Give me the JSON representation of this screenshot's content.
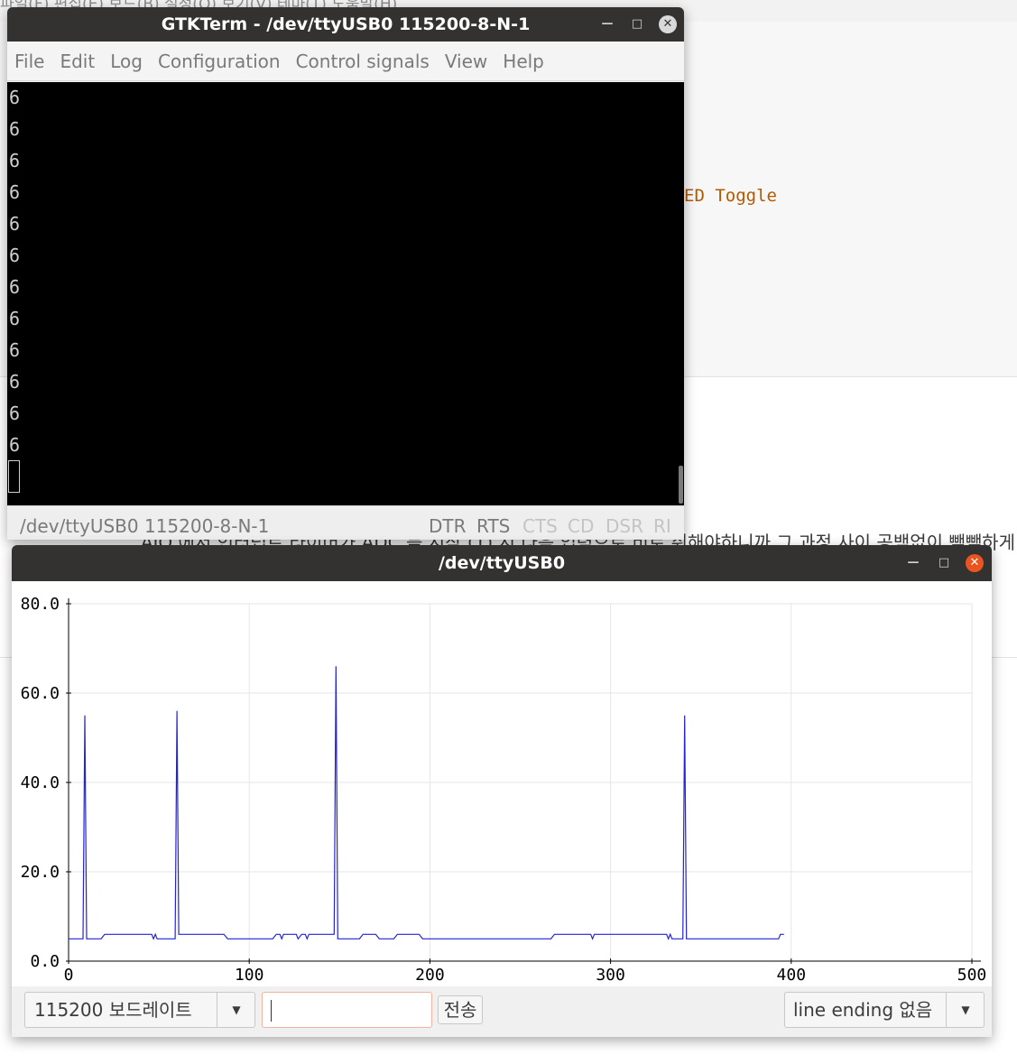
{
  "background": {
    "menubar_text": "파일(F)   편집(E)   보드(B)   설정(O)   보기(V)   테마(T)   도움말(H)",
    "code_snippet": "ED Toggle",
    "body_text": "AIO 에서 인터럽트 타이머가 ADC 를 시작 (1) 시 다음 입력으로 비로 취해야하니까 그 과정 사이 공백없이 빽빽하게"
  },
  "gtkterm": {
    "title": "GTKTerm - /dev/ttyUSB0  115200-8-N-1",
    "minimize_icon": "minimize-icon",
    "maximize_icon": "maximize-icon",
    "close_icon": "close-icon",
    "menu": [
      "File",
      "Edit",
      "Log",
      "Configuration",
      "Control signals",
      "View",
      "Help"
    ],
    "terminal_lines": [
      "6",
      "6",
      "6",
      "6",
      "6",
      "6",
      "6",
      "6",
      "6",
      "6",
      "6",
      "6"
    ],
    "status_port": "/dev/ttyUSB0  115200-8-N-1",
    "signals": [
      {
        "label": "DTR",
        "active": true
      },
      {
        "label": "RTS",
        "active": true
      },
      {
        "label": "CTS",
        "active": false
      },
      {
        "label": "CD",
        "active": false
      },
      {
        "label": "DSR",
        "active": false
      },
      {
        "label": "RI",
        "active": false
      }
    ]
  },
  "plotter": {
    "title": "/dev/ttyUSB0",
    "minimize_icon": "minimize-icon",
    "maximize_icon": "maximize-icon",
    "close_icon": "close-icon",
    "baud_label": "115200 보드레이트",
    "send_button": "전송",
    "input_value": "",
    "line_ending_label": "line ending 없음",
    "colors": {
      "line": "#2323d8",
      "close": "#e95420",
      "grid": "#e6e6e6"
    }
  },
  "chart_data": {
    "type": "line",
    "xlim": [
      0,
      500
    ],
    "ylim": [
      0,
      80
    ],
    "x_ticks": [
      "0",
      "100",
      "200",
      "300",
      "400",
      "500"
    ],
    "y_ticks": [
      "0.0",
      "20.0",
      "40.0",
      "60.0",
      "80.0"
    ],
    "grid": true,
    "series": [
      {
        "points": [
          [
            0,
            5
          ],
          [
            8,
            5
          ],
          [
            9,
            55
          ],
          [
            10,
            5
          ],
          [
            18,
            5
          ],
          [
            20,
            6
          ],
          [
            46,
            6
          ],
          [
            47,
            5
          ],
          [
            48,
            6
          ],
          [
            49,
            5
          ],
          [
            59,
            5
          ],
          [
            60,
            56
          ],
          [
            61,
            6
          ],
          [
            86,
            6
          ],
          [
            88,
            5
          ],
          [
            113,
            5
          ],
          [
            115,
            6
          ],
          [
            117,
            6
          ],
          [
            118,
            5
          ],
          [
            119,
            6
          ],
          [
            126,
            6
          ],
          [
            127,
            5
          ],
          [
            129,
            6
          ],
          [
            131,
            6
          ],
          [
            132,
            5
          ],
          [
            133,
            6
          ],
          [
            147,
            6
          ],
          [
            148,
            66
          ],
          [
            149,
            5
          ],
          [
            161,
            5
          ],
          [
            163,
            6
          ],
          [
            170,
            6
          ],
          [
            172,
            5
          ],
          [
            180,
            5
          ],
          [
            182,
            6
          ],
          [
            194,
            6
          ],
          [
            196,
            5
          ],
          [
            267,
            5
          ],
          [
            269,
            6
          ],
          [
            289,
            6
          ],
          [
            290,
            5
          ],
          [
            291,
            6
          ],
          [
            331,
            6
          ],
          [
            332,
            5
          ],
          [
            333,
            6
          ],
          [
            334,
            5
          ],
          [
            340,
            5
          ],
          [
            341,
            55
          ],
          [
            342,
            5
          ],
          [
            393,
            5
          ],
          [
            394,
            6
          ],
          [
            396,
            6
          ]
        ]
      }
    ]
  }
}
